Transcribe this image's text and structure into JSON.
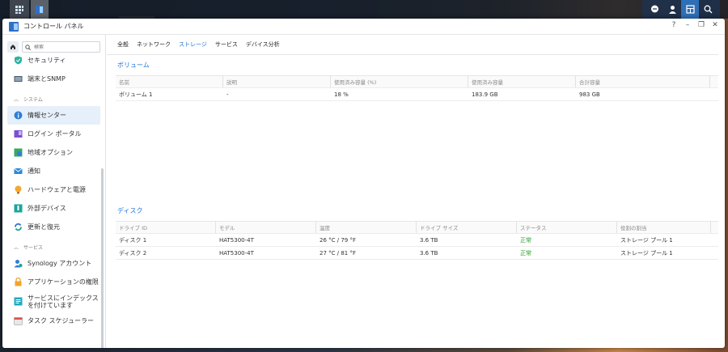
{
  "window": {
    "title": "コントロール パネル",
    "controls": [
      "?",
      "–",
      "❐",
      "✕"
    ]
  },
  "search": {
    "placeholder": "検索"
  },
  "sidebar": {
    "items": [
      {
        "label": "セキュリティ",
        "icon": "shield-icon",
        "color": "#2bb5a0"
      },
      {
        "label": "端末とSNMP",
        "icon": "terminal-icon",
        "color": "#4a5a6a"
      }
    ],
    "section_system": "システム",
    "system_items": [
      {
        "label": "情報センター",
        "icon": "info-icon",
        "color": "#2f7fd8",
        "active": true
      },
      {
        "label": "ログイン ポータル",
        "icon": "portal-icon",
        "color": "#7b4fd0"
      },
      {
        "label": "地域オプション",
        "icon": "globe-icon",
        "color": "#3aa860"
      },
      {
        "label": "通知",
        "icon": "bell-icon",
        "color": "#2f86d8"
      },
      {
        "label": "ハードウェアと電源",
        "icon": "bulb-icon",
        "color": "#f2a933"
      },
      {
        "label": "外部デバイス",
        "icon": "usb-icon",
        "color": "#1aa59a"
      },
      {
        "label": "更新と復元",
        "icon": "refresh-icon",
        "color": "#2e73c9"
      }
    ],
    "section_services": "サービス",
    "service_items": [
      {
        "label": "Synology アカウント",
        "icon": "account-icon",
        "color": "#2f7fd8"
      },
      {
        "label": "アプリケーションの権限",
        "icon": "lock-icon",
        "color": "#f0a52a"
      },
      {
        "label": "サービスにインデックスを付けています",
        "icon": "index-icon",
        "color": "#23a8c2"
      },
      {
        "label": "タスク スケジューラー",
        "icon": "calendar-icon",
        "color": "#d9534f"
      }
    ]
  },
  "tabs": [
    {
      "label": "全般",
      "active": false
    },
    {
      "label": "ネットワーク",
      "active": false
    },
    {
      "label": "ストレージ",
      "active": true
    },
    {
      "label": "サービス",
      "active": false
    },
    {
      "label": "デバイス分析",
      "active": false
    }
  ],
  "volume": {
    "title": "ボリューム",
    "headers": [
      "名前",
      "説明",
      "使用済み容量 (%)",
      "使用済み容量",
      "合計容量"
    ],
    "rows": [
      [
        "ボリューム 1",
        "-",
        "18 %",
        "183.9 GB",
        "983 GB"
      ]
    ]
  },
  "disk": {
    "title": "ディスク",
    "headers": [
      "ドライブ ID",
      "モデル",
      "温度",
      "ドライブ サイズ",
      "ステータス",
      "役割の割当"
    ],
    "rows": [
      [
        "ディスク 1",
        "HAT5300-4T",
        "26 °C / 79 °F",
        "3.6 TB",
        "正常",
        "ストレージ プール 1"
      ],
      [
        "ディスク 2",
        "HAT5300-4T",
        "27 °C / 81 °F",
        "3.6 TB",
        "正常",
        "ストレージ プール 1"
      ]
    ]
  },
  "colors": {
    "accent": "#1b73d6",
    "ok": "#2a9d2a"
  }
}
